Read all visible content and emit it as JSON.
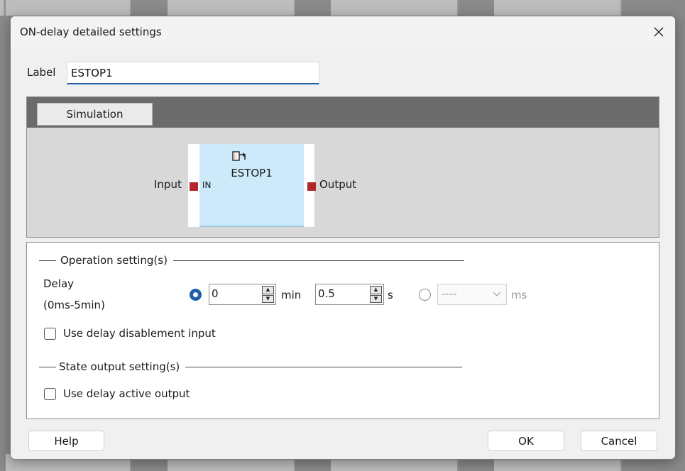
{
  "dialog": {
    "title": "ON-delay detailed settings"
  },
  "label_field": {
    "caption": "Label",
    "value": "ESTOP1"
  },
  "simulation": {
    "button_label": "Simulation",
    "block_name": "ESTOP1",
    "in_port_label": "IN",
    "input_label": "Input",
    "output_label": "Output"
  },
  "operation": {
    "group_title": "Operation setting(s)",
    "delay_label_line1": "Delay",
    "delay_label_line2": "(0ms-5min)",
    "min_value": "0",
    "min_unit": "min",
    "sec_value": "0.5",
    "sec_unit": "s",
    "ms_value": "----",
    "ms_unit": "ms",
    "use_disable_input_label": "Use delay disablement input"
  },
  "state_output": {
    "group_title": "State output setting(s)",
    "use_active_output_label": "Use delay active output"
  },
  "footer": {
    "help": "Help",
    "ok": "OK",
    "cancel": "Cancel"
  },
  "colors": {
    "accent": "#1f5fa8",
    "port": "#b3262a",
    "block": "#cdeafa"
  }
}
